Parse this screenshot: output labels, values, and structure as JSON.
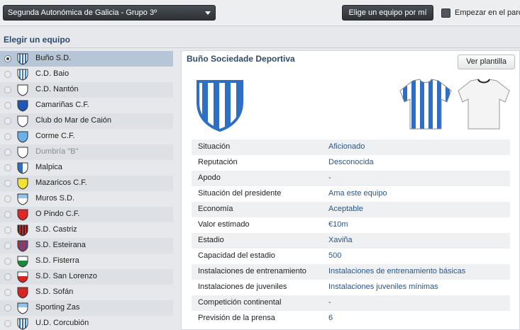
{
  "topbar": {
    "league_select": "Segunda Autonómica de Galicia - Grupo 3º",
    "pick_button": "Elige un equipo por mí",
    "start_label": "Empezar en el parc"
  },
  "section_title": "Elegir un equipo",
  "teams": [
    {
      "name": "Buño S.D.",
      "selected": true
    },
    {
      "name": "C.D. Baio"
    },
    {
      "name": "C.D. Nantón"
    },
    {
      "name": "Camariñas C.F."
    },
    {
      "name": "Club do Mar de Caión"
    },
    {
      "name": "Corme C.F."
    },
    {
      "name": "Dumbría \"B\"",
      "disabled": true
    },
    {
      "name": "Malpica"
    },
    {
      "name": "Mazaricos C.F."
    },
    {
      "name": "Muros S.D."
    },
    {
      "name": "O Pindo C.F."
    },
    {
      "name": "S.D. Castriz"
    },
    {
      "name": "S.D. Esteirana"
    },
    {
      "name": "S.D. Fisterra"
    },
    {
      "name": "S.D. San Lorenzo"
    },
    {
      "name": "S.D. Sofán"
    },
    {
      "name": "Sporting Zas"
    },
    {
      "name": "U.D. Corcubión"
    }
  ],
  "detail": {
    "title": "Buño Sociedade Deportiva",
    "squad_button": "Ver plantilla",
    "rows": [
      {
        "label": "Situación",
        "value": "Aficionado"
      },
      {
        "label": "Reputación",
        "value": "Desconocida"
      },
      {
        "label": "Apodo",
        "value": "-"
      },
      {
        "label": "Situación del presidente",
        "value": "Ama este equipo"
      },
      {
        "label": "Economía",
        "value": "Aceptable"
      },
      {
        "label": "Valor estimado",
        "value": "€10m"
      },
      {
        "label": "Estadio",
        "value": "Xaviña"
      },
      {
        "label": "Capacidad del estadio",
        "value": "500"
      },
      {
        "label": "Instalaciones de entrenamiento",
        "value": "Instalaciones de entrenamiento básicas"
      },
      {
        "label": "Instalaciones de juveniles",
        "value": "Instalaciones juveniles mínimas"
      },
      {
        "label": "Competición continental",
        "value": "-"
      },
      {
        "label": "Previsión de la prensa",
        "value": "6"
      }
    ]
  },
  "colors": {
    "accent_blue": "#2d6fc4",
    "title_blue": "#2d4b6c",
    "value_blue": "#2a5586",
    "selected_row": "#b7c6d6"
  },
  "crests": [
    {
      "style": "stripes",
      "c1": "#ffffff",
      "c2": "#2d6fc4"
    },
    {
      "style": "stripes",
      "c1": "#ffffff",
      "c2": "#3f7fcf"
    },
    {
      "style": "solid",
      "c1": "#ffffff",
      "c2": "#ffffff"
    },
    {
      "style": "solid",
      "c1": "#1f56b8",
      "c2": "#1f56b8"
    },
    {
      "style": "solid",
      "c1": "#ffffff",
      "c2": "#2d6fc4"
    },
    {
      "style": "solid",
      "c1": "#6ab0ea",
      "c2": "#6ab0ea"
    },
    {
      "style": "solid",
      "c1": "#ffffff",
      "c2": "#ffffff"
    },
    {
      "style": "half",
      "c1": "#ffffff",
      "c2": "#2d6fc4"
    },
    {
      "style": "solid",
      "c1": "#f2e233",
      "c2": "#f2e233"
    },
    {
      "style": "band",
      "c1": "#ffffff",
      "c2": "#8ec6f0"
    },
    {
      "style": "solid",
      "c1": "#e02626",
      "c2": "#e02626"
    },
    {
      "style": "stripes",
      "c1": "#2a2a2a",
      "c2": "#d42424"
    },
    {
      "style": "stripes",
      "c1": "#d42424",
      "c2": "#2d56b8"
    },
    {
      "style": "band",
      "c1": "#1a8a3a",
      "c2": "#ffffff"
    },
    {
      "style": "band",
      "c1": "#d42424",
      "c2": "#ffffff"
    },
    {
      "style": "solid",
      "c1": "#d42424",
      "c2": "#d42424"
    },
    {
      "style": "band",
      "c1": "#ffffff",
      "c2": "#8ec6f0"
    },
    {
      "style": "stripes",
      "c1": "#ffffff",
      "c2": "#2d6fc4"
    }
  ]
}
